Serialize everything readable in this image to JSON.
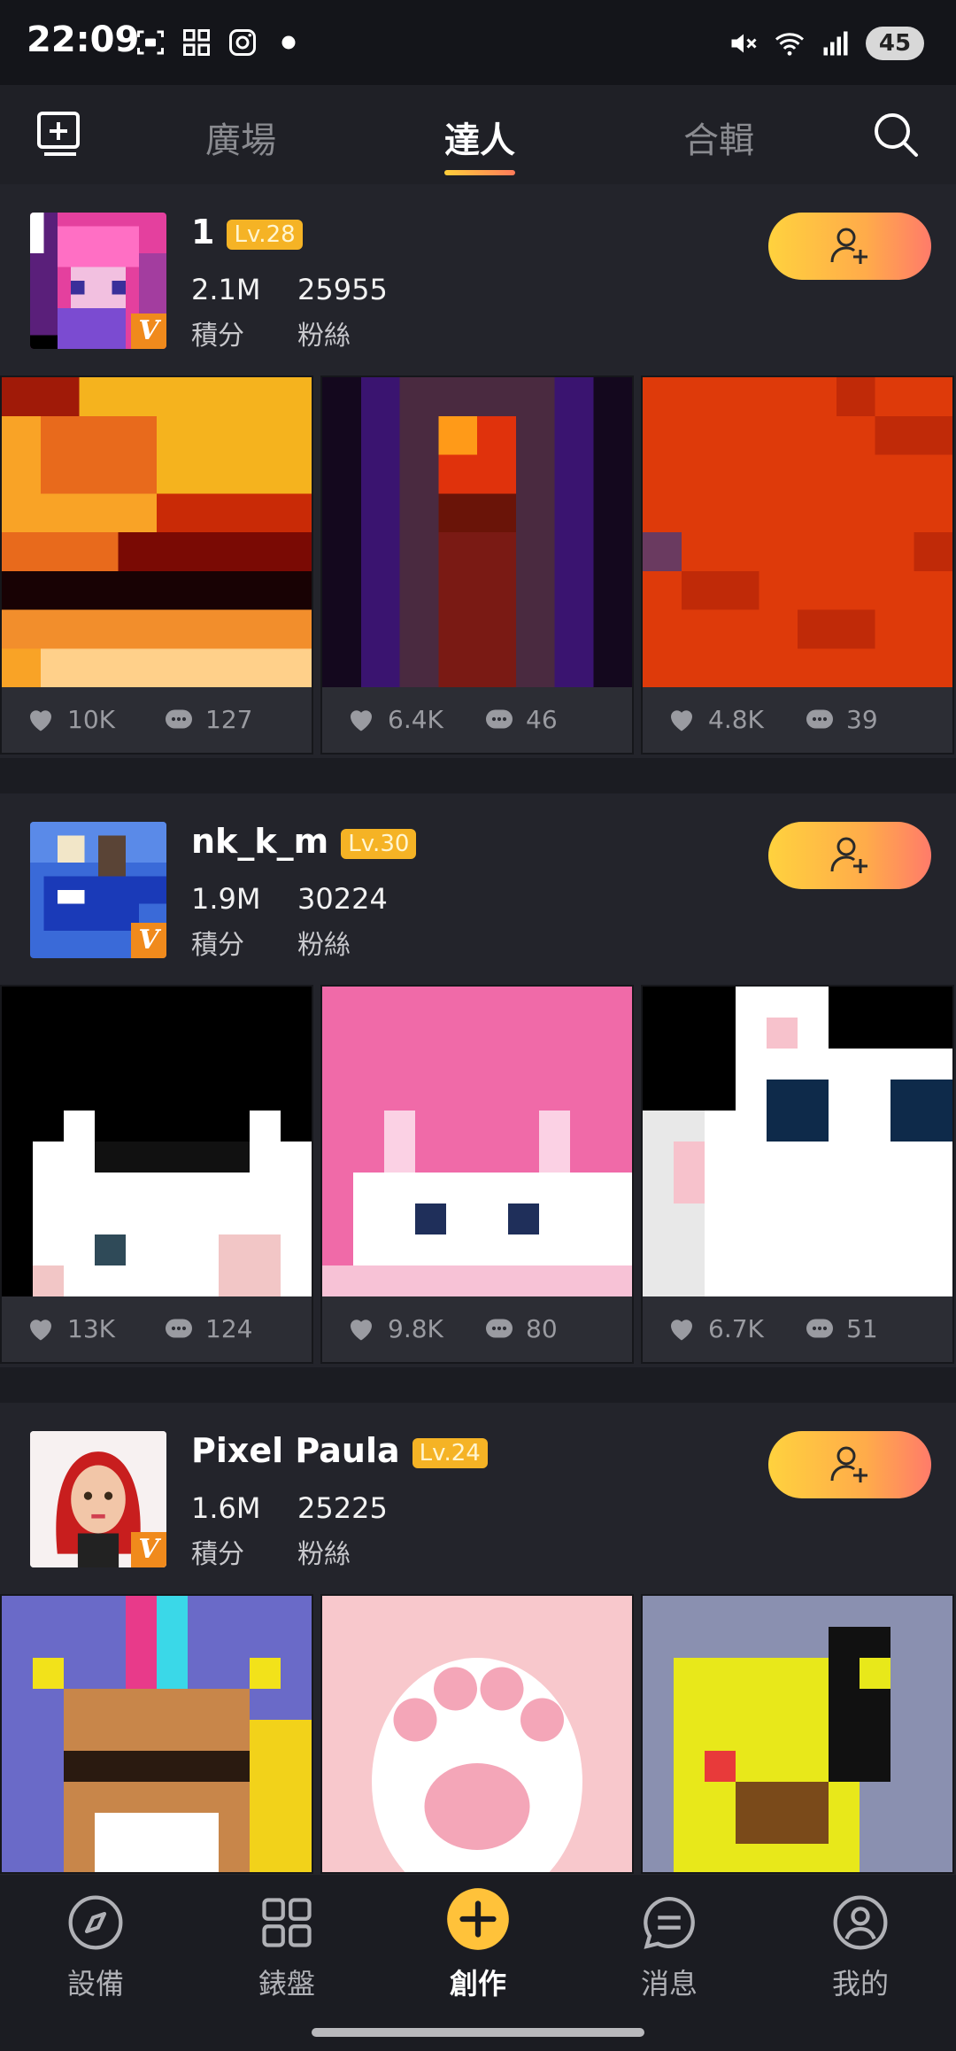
{
  "status_bar": {
    "time": "22:09",
    "battery": "45"
  },
  "top_nav": {
    "tabs": [
      {
        "label": "廣場",
        "active": false
      },
      {
        "label": "達人",
        "active": true
      },
      {
        "label": "合輯",
        "active": false
      }
    ]
  },
  "users": [
    {
      "name": "1",
      "level": "Lv.28",
      "points": "2.1M",
      "points_label": "積分",
      "fans": "25955",
      "fans_label": "粉絲",
      "works": [
        {
          "likes": "10K",
          "comments": "127"
        },
        {
          "likes": "6.4K",
          "comments": "46"
        },
        {
          "likes": "4.8K",
          "comments": "39"
        }
      ]
    },
    {
      "name": "nk_k_m",
      "level": "Lv.30",
      "points": "1.9M",
      "points_label": "積分",
      "fans": "30224",
      "fans_label": "粉絲",
      "works": [
        {
          "likes": "13K",
          "comments": "124"
        },
        {
          "likes": "9.8K",
          "comments": "80"
        },
        {
          "likes": "6.7K",
          "comments": "51"
        }
      ]
    },
    {
      "name": "Pixel Paula",
      "level": "Lv.24",
      "points": "1.6M",
      "points_label": "積分",
      "fans": "25225",
      "fans_label": "粉絲",
      "works": [
        {},
        {},
        {}
      ]
    }
  ],
  "bottom_nav": [
    {
      "label": "設備",
      "icon": "compass-icon"
    },
    {
      "label": "錶盤",
      "icon": "grid-icon"
    },
    {
      "label": "創作",
      "icon": "plus-circle-icon"
    },
    {
      "label": "消息",
      "icon": "message-icon"
    },
    {
      "label": "我的",
      "icon": "profile-icon"
    }
  ],
  "colors": {
    "accent": "#ffc23a",
    "follow_end": "#ff7b6a",
    "verified": "#f08a1c"
  }
}
